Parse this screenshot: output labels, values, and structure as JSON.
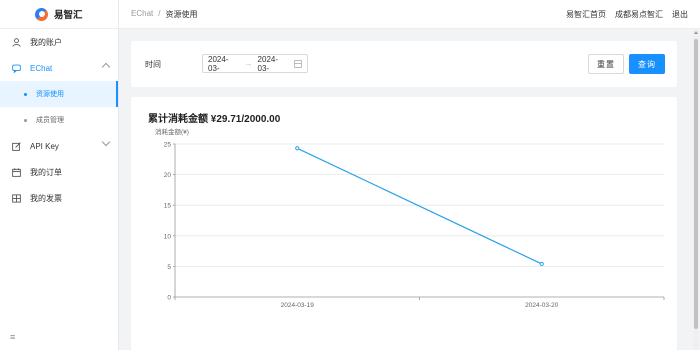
{
  "logo": {
    "text": "易智汇"
  },
  "sidebar": {
    "items": [
      {
        "label": "我的账户",
        "icon": "user-icon"
      },
      {
        "label": "EChat",
        "icon": "chat-icon",
        "children": [
          {
            "label": "资源使用"
          },
          {
            "label": "成员管理"
          }
        ]
      },
      {
        "label": "API Key",
        "icon": "edit-icon"
      },
      {
        "label": "我的订单",
        "icon": "calendar-icon"
      },
      {
        "label": "我的发票",
        "icon": "table-icon"
      }
    ],
    "collapse_icon": "≡"
  },
  "header": {
    "breadcrumb": [
      "EChat",
      "/",
      "资源使用"
    ],
    "links": [
      "易智汇首页",
      "成都易点智汇",
      "退出"
    ]
  },
  "filter": {
    "time_label": "时间",
    "start_date": "2024-03-",
    "end_date": "2024-03-",
    "separator": "→",
    "reset_label": "重置",
    "query_label": "查询"
  },
  "summary": {
    "title": "累计消耗金额 ¥29.71/2000.00"
  },
  "colors": {
    "accent": "#1890ff",
    "line": "#2aa2e8"
  },
  "chart_data": {
    "type": "line",
    "ylabel": "消耗金额(¥)",
    "categories": [
      "2024-03-19",
      "2024-03-20"
    ],
    "values": [
      24.3,
      5.4
    ],
    "ylim": [
      0,
      25
    ],
    "yticks": [
      0,
      5,
      10,
      15,
      20,
      25
    ],
    "grid": true
  }
}
